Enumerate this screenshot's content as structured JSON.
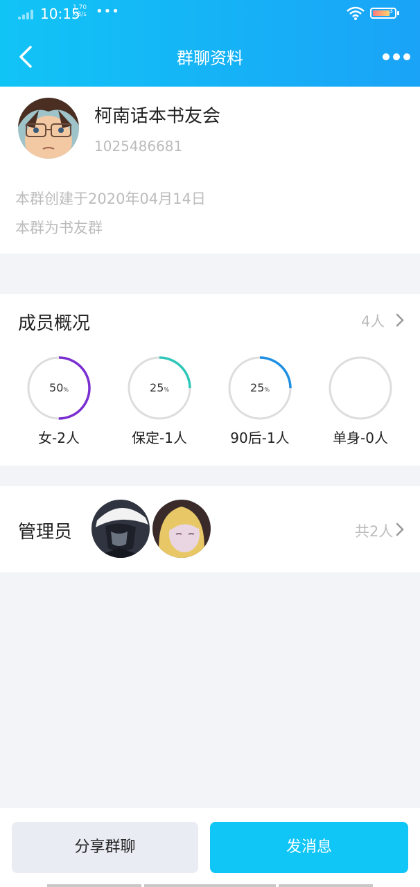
{
  "status_bar": {
    "time": "10:15",
    "speed_value": "1.70",
    "speed_unit": "KB/s",
    "dots": "•••",
    "battery": "3"
  },
  "nav": {
    "title": "群聊资料"
  },
  "group": {
    "name": "柯南话本书友会",
    "id": "1025486681",
    "created": "本群创建于2020年04月14日",
    "description": "本群为书友群"
  },
  "members": {
    "title": "成员概况",
    "count": "4人",
    "stats": [
      {
        "percent": "50",
        "percent_sign": "%",
        "label": "女-2人",
        "fraction": 0.5,
        "color": "#7a2fd0"
      },
      {
        "percent": "25",
        "percent_sign": "%",
        "label": "保定-1人",
        "fraction": 0.25,
        "color": "#2ec7b8"
      },
      {
        "percent": "25",
        "percent_sign": "%",
        "label": "90后-1人",
        "fraction": 0.25,
        "color": "#1e8fe3"
      },
      {
        "percent": "",
        "percent_sign": "",
        "label": "单身-0人",
        "fraction": 0,
        "color": "#cccccc"
      }
    ]
  },
  "admins": {
    "title": "管理员",
    "count": "共2人"
  },
  "actions": {
    "share": "分享群聊",
    "send": "发消息"
  },
  "colors": {
    "header_start": "#11c4f6",
    "header_end": "#1aa3f7",
    "accent": "#10c6f7",
    "track": "#dddddd"
  }
}
